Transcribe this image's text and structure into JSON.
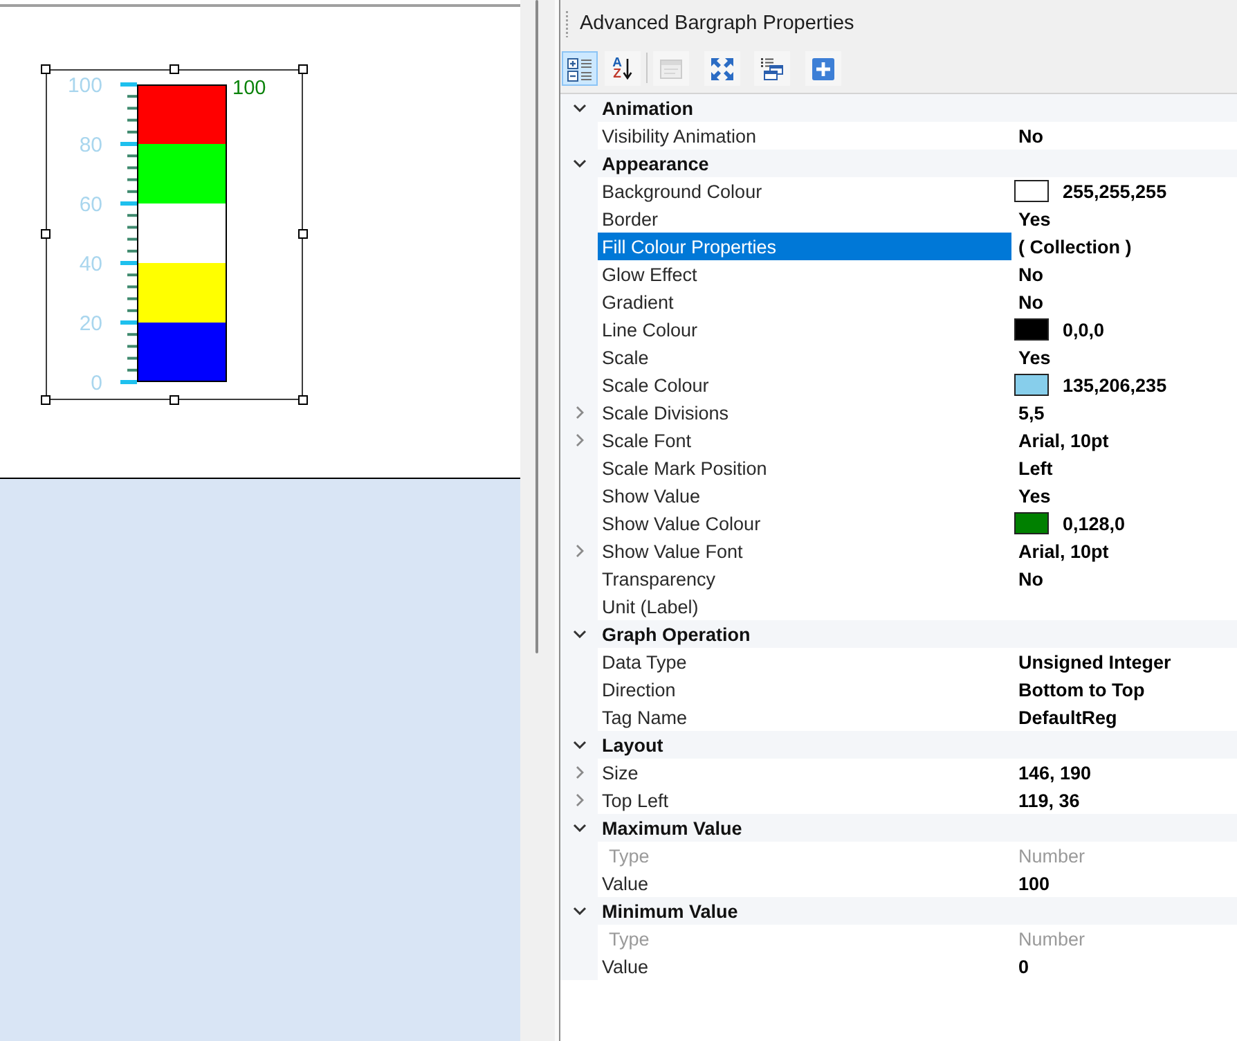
{
  "canvas": {
    "bargraph": {
      "selected": true,
      "scale_labels": [
        "100",
        "80",
        "60",
        "40",
        "20",
        "0"
      ],
      "value_label": "100",
      "segments": [
        {
          "color": "#ff0000"
        },
        {
          "color": "#00ff00"
        },
        {
          "color": "#ffffff"
        },
        {
          "color": "#ffff00"
        },
        {
          "color": "#0000ff"
        }
      ]
    }
  },
  "properties_panel": {
    "title": "Advanced Bargraph Properties",
    "toolbar": [
      {
        "selected": true,
        "disabled": false
      },
      {
        "selected": false,
        "disabled": false,
        "letters": [
          "A",
          "Z"
        ]
      },
      {
        "selected": false,
        "disabled": true
      },
      {
        "selected": false,
        "disabled": false
      },
      {
        "selected": false,
        "disabled": false
      },
      {
        "selected": false,
        "disabled": false
      }
    ],
    "categories": [
      {
        "label": "Animation",
        "expanded": true,
        "properties": [
          {
            "name": "Visibility Animation",
            "value": "No",
            "expandable": false,
            "selected": false,
            "disabled": false
          }
        ]
      },
      {
        "label": "Appearance",
        "expanded": true,
        "properties": [
          {
            "name": "Background Colour",
            "value": "255,255,255",
            "color": "#ffffff",
            "expandable": false,
            "selected": false,
            "disabled": false
          },
          {
            "name": "Border",
            "value": "Yes",
            "expandable": false,
            "selected": false,
            "disabled": false
          },
          {
            "name": "Fill Colour Properties",
            "value": "( Collection )",
            "expandable": false,
            "selected": true,
            "disabled": false
          },
          {
            "name": "Glow Effect",
            "value": "No",
            "expandable": false,
            "selected": false,
            "disabled": false
          },
          {
            "name": "Gradient",
            "value": "No",
            "expandable": false,
            "selected": false,
            "disabled": false
          },
          {
            "name": "Line Colour",
            "value": "0,0,0",
            "color": "#000000",
            "expandable": false,
            "selected": false,
            "disabled": false
          },
          {
            "name": "Scale",
            "value": "Yes",
            "expandable": false,
            "selected": false,
            "disabled": false
          },
          {
            "name": "Scale Colour",
            "value": "135,206,235",
            "color": "#87ceeb",
            "expandable": false,
            "selected": false,
            "disabled": false
          },
          {
            "name": "Scale Divisions",
            "value": "5,5",
            "expandable": true,
            "selected": false,
            "disabled": false
          },
          {
            "name": "Scale Font",
            "value": "Arial, 10pt",
            "expandable": true,
            "selected": false,
            "disabled": false
          },
          {
            "name": "Scale Mark Position",
            "value": "Left",
            "expandable": false,
            "selected": false,
            "disabled": false
          },
          {
            "name": "Show Value",
            "value": "Yes",
            "expandable": false,
            "selected": false,
            "disabled": false
          },
          {
            "name": "Show Value Colour",
            "value": "0,128,0",
            "color": "#008000",
            "expandable": false,
            "selected": false,
            "disabled": false
          },
          {
            "name": "Show Value Font",
            "value": "Arial, 10pt",
            "expandable": true,
            "selected": false,
            "disabled": false
          },
          {
            "name": "Transparency",
            "value": "No",
            "expandable": false,
            "selected": false,
            "disabled": false
          },
          {
            "name": "Unit (Label)",
            "expandable": false,
            "selected": false,
            "disabled": false
          }
        ]
      },
      {
        "label": "Graph Operation",
        "expanded": true,
        "properties": [
          {
            "name": "Data Type",
            "value": "Unsigned Integer",
            "expandable": false,
            "selected": false,
            "disabled": false
          },
          {
            "name": "Direction",
            "value": "Bottom to Top",
            "expandable": false,
            "selected": false,
            "disabled": false
          },
          {
            "name": "Tag Name",
            "value": "DefaultReg",
            "expandable": false,
            "selected": false,
            "disabled": false
          }
        ]
      },
      {
        "label": "Layout",
        "expanded": true,
        "properties": [
          {
            "name": "Size",
            "value": "146, 190",
            "expandable": true,
            "selected": false,
            "disabled": false
          },
          {
            "name": "Top Left",
            "value": "119, 36",
            "expandable": true,
            "selected": false,
            "disabled": false
          }
        ]
      },
      {
        "label": "Maximum Value",
        "expanded": true,
        "properties": [
          {
            "name": "Type",
            "value": "Number",
            "expandable": false,
            "selected": false,
            "disabled": true
          },
          {
            "name": "Value",
            "value": "100",
            "expandable": false,
            "selected": false,
            "disabled": false
          }
        ]
      },
      {
        "label": "Minimum Value",
        "expanded": true,
        "properties": [
          {
            "name": "Type",
            "value": "Number",
            "expandable": false,
            "selected": false,
            "disabled": true
          },
          {
            "name": "Value",
            "value": "0",
            "expandable": false,
            "selected": false,
            "disabled": false
          }
        ]
      }
    ]
  }
}
